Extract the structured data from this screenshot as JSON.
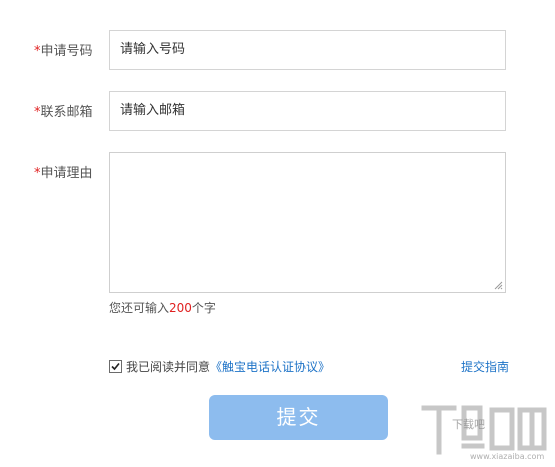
{
  "form": {
    "required_mark": "*",
    "phone": {
      "label": "申请号码",
      "value": "请输入号码"
    },
    "email": {
      "label": "联系邮箱",
      "value": "请输入邮箱"
    },
    "reason": {
      "label": "申请理由",
      "value": ""
    },
    "counter": {
      "prefix": "您还可输入",
      "count": "200",
      "suffix": "个字"
    },
    "agreement": {
      "checked": true,
      "text": "我已阅读并同意",
      "link": "《触宝电话认证协议》"
    },
    "guide_link": "提交指南",
    "submit_label": "提交"
  },
  "watermark": {
    "site_name": "下载吧",
    "url": "www.xiazaiba.com"
  },
  "colors": {
    "required": "#e02020",
    "link": "#1e73c7",
    "submit_bg": "#8dbcee",
    "border": "#d4d4d4"
  },
  "icons": {
    "checkbox": "check-icon",
    "resize": "resize-grip-icon"
  }
}
